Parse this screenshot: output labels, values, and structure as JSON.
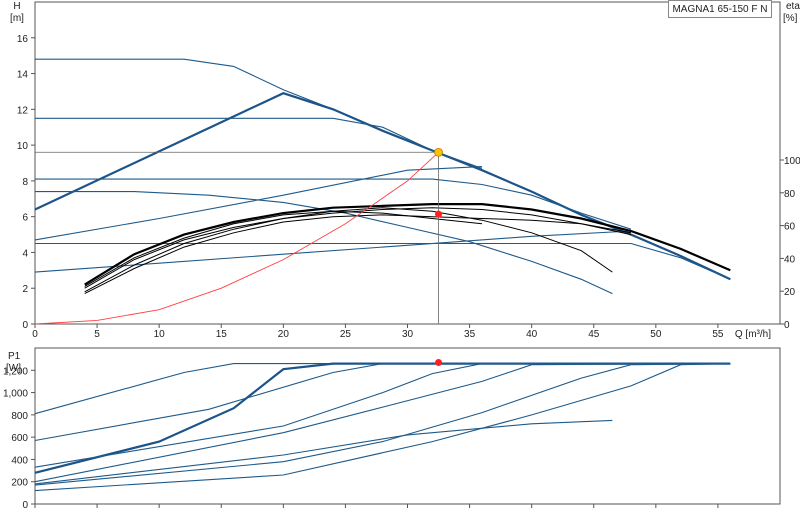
{
  "product": "MAGNA1 65-150 F N",
  "colors": {
    "curve": "#1e5a8a",
    "bold_curve": "#1c5489",
    "eff_curve": "#000000",
    "system_curve": "#ff4040",
    "duty_point": "#ff2020",
    "duty_point_top": "#ffc000",
    "axis": "#555555"
  },
  "chart_data": [
    {
      "type": "line",
      "xlabel": "Q [m³/h]",
      "ylabel": "H [m]",
      "y2label": "eta [%]",
      "xlim": [
        0,
        60
      ],
      "ylim": [
        0,
        18
      ],
      "y2lim": [
        0,
        100
      ],
      "xticks": [
        0,
        5,
        10,
        15,
        20,
        25,
        30,
        35,
        40,
        45,
        50,
        55
      ],
      "yticks": [
        0,
        2,
        4,
        6,
        8,
        10,
        12,
        14,
        16
      ],
      "y2ticks": [
        0,
        20,
        40,
        60,
        80,
        100
      ],
      "grid": false,
      "duty_point": {
        "q": 32.5,
        "h": 9.6,
        "eta": 67
      },
      "head_curves": [
        {
          "style": "thin",
          "points": [
            [
              0,
              14.8
            ],
            [
              12,
              14.8
            ],
            [
              16,
              14.4
            ],
            [
              20,
              13.1
            ],
            [
              24,
              12
            ],
            [
              28,
              10.8
            ],
            [
              32,
              9.7
            ],
            [
              36,
              8.6
            ],
            [
              40,
              7.4
            ],
            [
              44,
              6.1
            ],
            [
              48,
              5
            ],
            [
              52,
              3.8
            ],
            [
              56,
              2.5
            ]
          ]
        },
        {
          "style": "bold",
          "points": [
            [
              0,
              6.4
            ],
            [
              20,
              12.9
            ],
            [
              24,
              12
            ],
            [
              28,
              10.8
            ],
            [
              32,
              9.7
            ],
            [
              36,
              8.6
            ],
            [
              40,
              7.4
            ],
            [
              44,
              6.1
            ],
            [
              48,
              5
            ],
            [
              52,
              3.8
            ],
            [
              56,
              2.5
            ]
          ]
        },
        {
          "style": "thin",
          "points": [
            [
              0,
              11.5
            ],
            [
              24,
              11.5
            ],
            [
              28,
              11
            ],
            [
              32,
              9.7
            ],
            [
              36,
              8.7
            ]
          ]
        },
        {
          "style": "thin",
          "points": [
            [
              0,
              8.1
            ],
            [
              32,
              8.1
            ],
            [
              36,
              7.8
            ],
            [
              40,
              7.2
            ],
            [
              44,
              6.2
            ],
            [
              48,
              5.3
            ]
          ]
        },
        {
          "style": "thin",
          "points": [
            [
              0,
              7.4
            ],
            [
              8,
              7.4
            ],
            [
              14,
              7.2
            ],
            [
              20,
              6.8
            ],
            [
              25,
              6.2
            ],
            [
              30,
              5.4
            ],
            [
              35,
              4.6
            ],
            [
              40,
              3.5
            ],
            [
              44,
              2.5
            ],
            [
              46.5,
              1.7
            ]
          ]
        },
        {
          "style": "thin",
          "points": [
            [
              0,
              4.5
            ],
            [
              48,
              4.5
            ],
            [
              52,
              3.7
            ],
            [
              56,
              2.5
            ]
          ]
        },
        {
          "style": "thin",
          "points": [
            [
              0,
              4.7
            ],
            [
              10,
              5.9
            ],
            [
              20,
              7.2
            ],
            [
              30,
              8.6
            ],
            [
              36,
              8.8
            ]
          ]
        },
        {
          "style": "thin",
          "points": [
            [
              0,
              2.9
            ],
            [
              10,
              3.4
            ],
            [
              20,
              3.9
            ],
            [
              30,
              4.4
            ],
            [
              40,
              4.9
            ],
            [
              48,
              5.2
            ]
          ]
        }
      ],
      "eff_curves": [
        {
          "style": "bold",
          "points": [
            [
              4,
              2.2
            ],
            [
              8,
              3.9
            ],
            [
              12,
              5
            ],
            [
              16,
              5.7
            ],
            [
              20,
              6.2
            ],
            [
              24,
              6.5
            ],
            [
              28,
              6.6
            ],
            [
              32,
              6.7
            ],
            [
              36,
              6.7
            ],
            [
              40,
              6.4
            ],
            [
              44,
              5.9
            ],
            [
              48,
              5.2
            ],
            [
              52,
              4.2
            ],
            [
              56,
              3
            ]
          ]
        },
        {
          "style": "thin",
          "points": [
            [
              4,
              2
            ],
            [
              8,
              3.6
            ],
            [
              12,
              4.7
            ],
            [
              16,
              5.4
            ],
            [
              20,
              5.9
            ],
            [
              24,
              6.2
            ],
            [
              28,
              6.4
            ],
            [
              32,
              6.5
            ],
            [
              36,
              6.4
            ],
            [
              40,
              6.1
            ],
            [
              44,
              5.6
            ],
            [
              48,
              5
            ]
          ]
        },
        {
          "style": "thin",
          "points": [
            [
              4,
              1.8
            ],
            [
              8,
              3.3
            ],
            [
              12,
              4.5
            ],
            [
              16,
              5.3
            ],
            [
              20,
              5.9
            ],
            [
              24,
              6.3
            ],
            [
              28,
              6.5
            ],
            [
              32,
              6.3
            ],
            [
              36,
              5.8
            ],
            [
              40,
              5.1
            ],
            [
              44,
              4.1
            ],
            [
              46.5,
              2.9
            ]
          ]
        },
        {
          "style": "thin",
          "points": [
            [
              4,
              1.7
            ],
            [
              8,
              3.1
            ],
            [
              12,
              4.3
            ],
            [
              16,
              5.1
            ],
            [
              20,
              5.7
            ],
            [
              24,
              6
            ],
            [
              28,
              6.1
            ],
            [
              32,
              6
            ],
            [
              36,
              5.9
            ],
            [
              40,
              5.8
            ],
            [
              44,
              5.6
            ],
            [
              48,
              5.1
            ]
          ]
        },
        {
          "style": "thin",
          "points": [
            [
              4,
              2.1
            ],
            [
              8,
              3.7
            ],
            [
              12,
              4.8
            ],
            [
              16,
              5.6
            ],
            [
              20,
              6.1
            ],
            [
              24,
              6.3
            ],
            [
              28,
              6.2
            ],
            [
              32,
              5.9
            ],
            [
              36,
              5.6
            ]
          ]
        }
      ],
      "system_curve": [
        [
          0,
          0
        ],
        [
          5,
          0.2
        ],
        [
          10,
          0.8
        ],
        [
          15,
          2
        ],
        [
          20,
          3.6
        ],
        [
          25,
          5.6
        ],
        [
          30,
          8
        ],
        [
          32.5,
          9.6
        ]
      ]
    },
    {
      "type": "line",
      "ylabel": "P1 [W]",
      "xlim": [
        0,
        60
      ],
      "ylim": [
        0,
        1400
      ],
      "yticks": [
        0,
        200,
        400,
        600,
        800,
        1000,
        1200
      ],
      "ytick_labels": [
        "0",
        "200",
        "400",
        "600",
        "800",
        "1,000",
        "1,200"
      ],
      "grid": false,
      "duty_point": {
        "q": 32.5,
        "p": 1270
      },
      "power_curves": [
        {
          "style": "thin",
          "points": [
            [
              0,
              810
            ],
            [
              12,
              1180
            ],
            [
              16,
              1260
            ],
            [
              56,
              1260
            ]
          ]
        },
        {
          "style": "bold",
          "points": [
            [
              0,
              280
            ],
            [
              10,
              560
            ],
            [
              16,
              860
            ],
            [
              20,
              1210
            ],
            [
              24,
              1260
            ],
            [
              56,
              1260
            ]
          ]
        },
        {
          "style": "thin",
          "points": [
            [
              0,
              570
            ],
            [
              14,
              850
            ],
            [
              24,
              1180
            ],
            [
              28,
              1260
            ],
            [
              56,
              1260
            ]
          ]
        },
        {
          "style": "thin",
          "points": [
            [
              0,
              330
            ],
            [
              20,
              700
            ],
            [
              28,
              1000
            ],
            [
              32,
              1170
            ],
            [
              36,
              1260
            ],
            [
              56,
              1260
            ]
          ]
        },
        {
          "style": "thin",
          "points": [
            [
              0,
              200
            ],
            [
              20,
              640
            ],
            [
              28,
              870
            ],
            [
              36,
              1100
            ],
            [
              40,
              1250
            ],
            [
              56,
              1260
            ]
          ]
        },
        {
          "style": "thin",
          "points": [
            [
              0,
              170
            ],
            [
              20,
              380
            ],
            [
              28,
              560
            ],
            [
              36,
              820
            ],
            [
              44,
              1130
            ],
            [
              48,
              1250
            ],
            [
              56,
              1260
            ]
          ]
        },
        {
          "style": "thin",
          "points": [
            [
              0,
              180
            ],
            [
              20,
              440
            ],
            [
              30,
              620
            ],
            [
              40,
              720
            ],
            [
              46.5,
              750
            ]
          ]
        },
        {
          "style": "thin",
          "points": [
            [
              0,
              120
            ],
            [
              20,
              260
            ],
            [
              32,
              560
            ],
            [
              40,
              800
            ],
            [
              48,
              1060
            ],
            [
              52,
              1250
            ],
            [
              56,
              1260
            ]
          ]
        }
      ]
    }
  ]
}
